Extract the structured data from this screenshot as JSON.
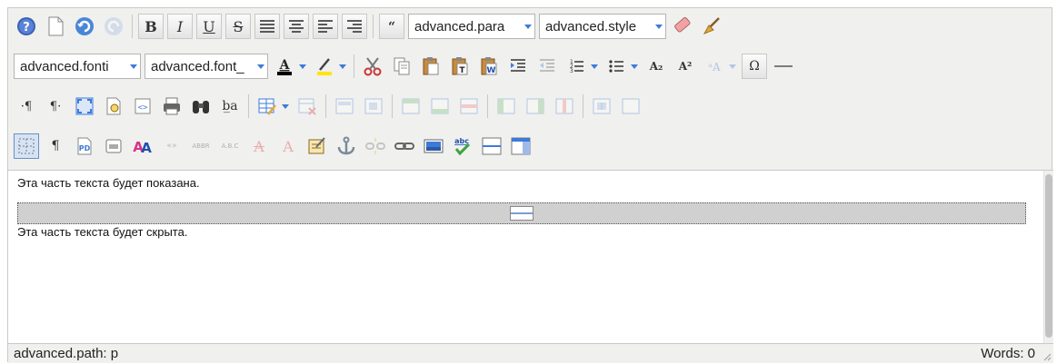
{
  "toolbar": {
    "format_select": "advanced.para",
    "style_select": "advanced.style",
    "font_family_select": "advanced.fonti",
    "font_size_select": "advanced.font_",
    "bold": "B",
    "italic": "I",
    "underline": "U",
    "strikethrough": "S",
    "subscript": "A₂",
    "superscript": "A²",
    "omega": "Ω",
    "ltr": "·¶",
    "rtl": "¶·",
    "nonbreaking": "¶",
    "insertlayer_text": "b̲a",
    "abbr": "ABBR",
    "acronym": "A.B.C",
    "cite": "«»",
    "del": "A",
    "ins": "A",
    "spellcheck": "abc"
  },
  "content": {
    "para1": "Эта часть текста будет показана.",
    "para2": "Эта часть текста будет скрыта."
  },
  "status": {
    "path": "advanced.path: p",
    "words": "Words: 0"
  }
}
